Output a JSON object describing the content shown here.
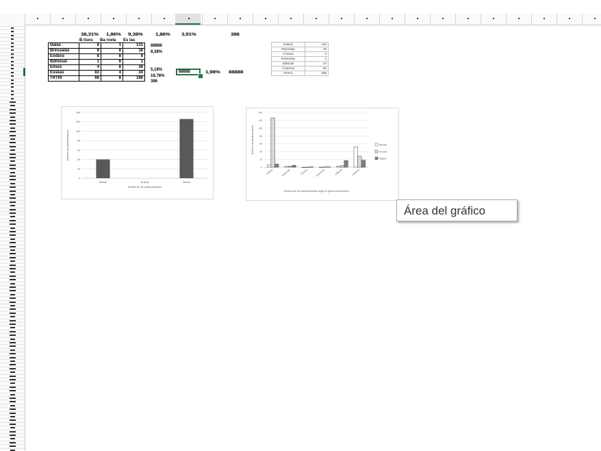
{
  "sheet": {
    "accent_color": "#217346",
    "header_row_a": [
      "38,31%",
      "1,86%",
      "9,38%",
      "1,86%",
      "3,91%",
      "386"
    ],
    "header_row_b": [
      "B ilsos",
      "Ba rcela",
      "Es las"
    ],
    "main_table": {
      "rows": [
        {
          "label": "Dalas",
          "v1": "8",
          "v2": "1",
          "v3": "131",
          "side": "88888"
        },
        {
          "label": "Bressalas",
          "v1": "8",
          "v2": "8",
          "v3": "18",
          "side": "8,38%"
        },
        {
          "label": "Esdass",
          "v1": "8",
          "v2": "8",
          "v3": "8",
          "side": ""
        },
        {
          "label": "Bdmesal",
          "v1": "1",
          "v2": "8",
          "v3": "1",
          "side": ""
        },
        {
          "label": "Ellses",
          "v1": "4",
          "v2": "8",
          "v3": "38",
          "side": "5,18%"
        },
        {
          "label": "Esseas",
          "v1": "83",
          "v2": "4",
          "v3": "34",
          "side": "18,78%"
        },
        {
          "label": "TRTRI",
          "v1": "68",
          "v2": "8",
          "v3": "186",
          "side": "386"
        }
      ]
    },
    "selected_cell_text": "88888",
    "after_selected": [
      "1,98%",
      "88888"
    ],
    "small_table": {
      "rows": [
        {
          "label": "Noticia",
          "value": "140"
        },
        {
          "label": "Reportaje",
          "value": "10"
        },
        {
          "label": "Crónica",
          "value": "0"
        },
        {
          "label": "Entrevista",
          "value": "2"
        },
        {
          "label": "Editorial",
          "value": "24"
        },
        {
          "label": "Columna",
          "value": "80"
        },
        {
          "label": "TOTAL",
          "value": "256"
        }
      ]
    },
    "tooltip": "Área del gráfico"
  },
  "chart_data": [
    {
      "type": "bar",
      "categories": [
        "Mierda",
        "Ni puta",
        "Nacha"
      ],
      "values": [
        40,
        0,
        126
      ],
      "ylim": [
        0,
        140
      ],
      "yticks": [
        "0",
        "20",
        "40",
        "60",
        "80",
        "100",
        "120",
        "140"
      ],
      "xlabel": "Ámbito de los parlamentarios",
      "ylabel": "Número de parlamentarios",
      "color": "#595959",
      "grid": true
    },
    {
      "type": "bar",
      "categories": [
        "Noticia",
        "Reportaje",
        "Crónica",
        "Entrevista",
        "Editorial",
        "Columna"
      ],
      "series": [
        {
          "name": "Mierda",
          "values": [
            6,
            2,
            0,
            0,
            3,
            52
          ],
          "color": "#ffffff"
        },
        {
          "name": "Ni puta",
          "values": [
            126,
            3,
            0,
            1,
            4,
            28
          ],
          "color": "#d9d9d9"
        },
        {
          "name": "Nacha",
          "values": [
            8,
            5,
            1,
            1,
            17,
            18
          ],
          "color": "#7f7f7f"
        }
      ],
      "ylim": [
        0,
        140
      ],
      "yticks": [
        "0",
        "20",
        "40",
        "60",
        "80",
        "100",
        "120",
        "140"
      ],
      "xlabel": "Géneros de los parlamentarios según el género periodístico",
      "ylabel": "Número de parlamentarios",
      "legend": "right",
      "grid": true
    }
  ]
}
